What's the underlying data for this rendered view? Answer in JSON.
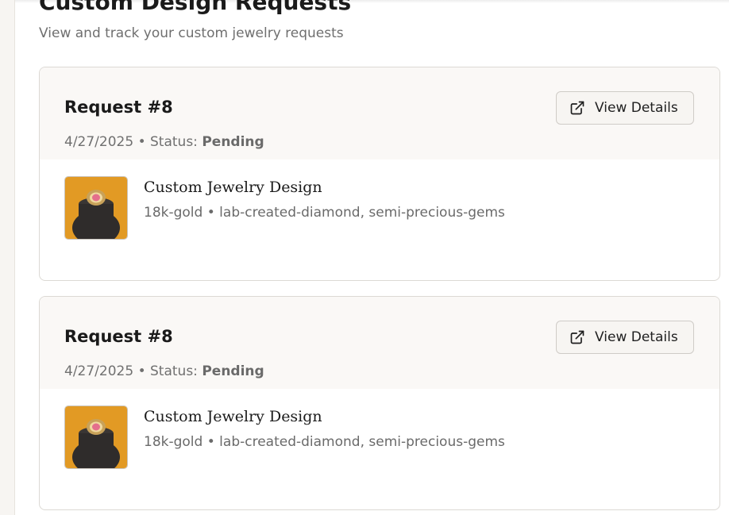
{
  "page": {
    "title": "Custom Design Requests",
    "subtitle": "View and track your custom jewelry requests"
  },
  "requests": [
    {
      "title": "Request #8",
      "date": "4/27/2025",
      "status_label": "Status:",
      "status": "Pending",
      "button_label": "View Details",
      "item": {
        "title": "Custom Jewelry Design",
        "metal": "18k-gold",
        "stones": "lab-created-diamond, semi-precious-gems"
      }
    },
    {
      "title": "Request #8",
      "date": "4/27/2025",
      "status_label": "Status:",
      "status": "Pending",
      "button_label": "View Details",
      "item": {
        "title": "Custom Jewelry Design",
        "metal": "18k-gold",
        "stones": "lab-created-diamond, semi-precious-gems"
      }
    }
  ],
  "separators": {
    "dot": "•"
  },
  "colors": {
    "background": "#ffffff",
    "card_header": "#faf8f6",
    "border": "#dcd9d4",
    "thumb_backdrop": "#e29a24",
    "thumb_stand": "#2f2c2b",
    "ring_gold": "#c8a25a",
    "ring_stone": "#e46f8c"
  },
  "icons": {
    "view_details": "external-link-icon"
  }
}
